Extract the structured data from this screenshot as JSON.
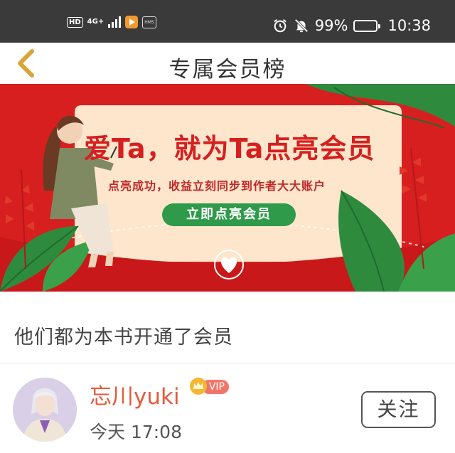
{
  "status_bar": {
    "hd": "HD",
    "network": "4G+",
    "hms": "HMS",
    "battery": "99%",
    "time": "10:38",
    "icons": [
      "alarm-icon",
      "mute-bell-icon",
      "battery-icon"
    ]
  },
  "header": {
    "title": "专属会员榜",
    "back_icon": "chevron-left-icon"
  },
  "banner": {
    "headline": "爱Ta，就为Ta点亮会员",
    "subtitle": "点亮成功，收益立刻同步到作者大大账户",
    "cta": "立即点亮会员",
    "colors": {
      "background": "#d81f1f",
      "card": "#fde6cc",
      "leaf": "#2e8b3e",
      "cta": "#2f9a4a"
    }
  },
  "section": {
    "title": "他们都为本书开通了会员"
  },
  "members": [
    {
      "name": "忘川yuki",
      "badge": "VIP",
      "time": "今天 17:08",
      "follow_label": "关注"
    }
  ]
}
